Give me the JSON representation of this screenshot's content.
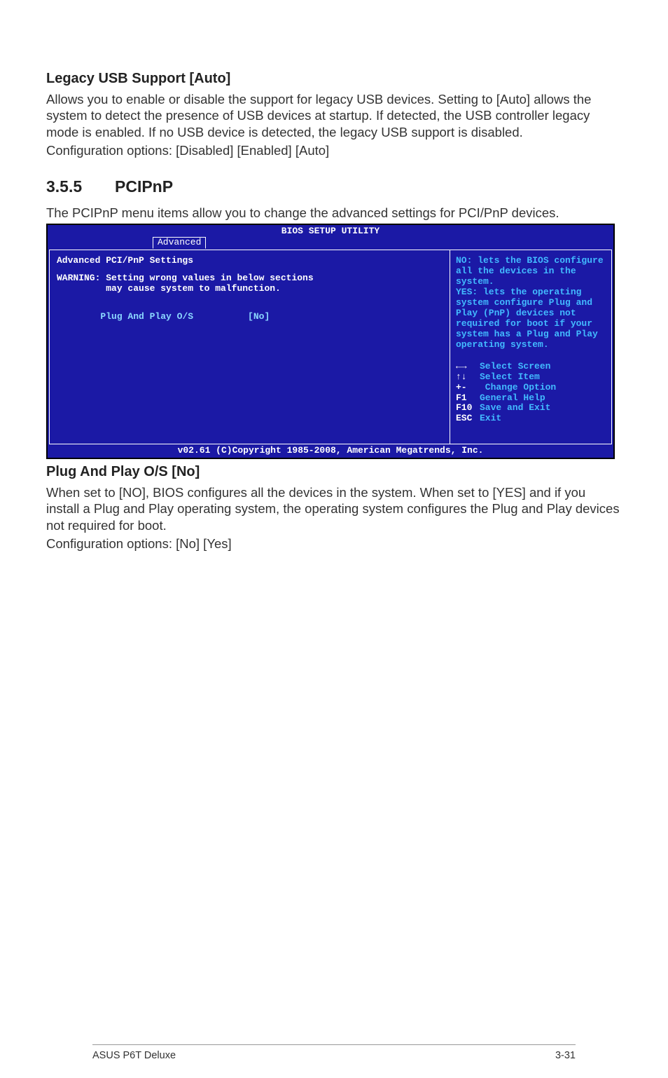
{
  "sect1": {
    "heading": "Legacy USB Support [Auto]",
    "p1": "Allows you to enable or disable the support for legacy USB devices. Setting to [Auto] allows the system to detect the presence of USB devices at startup. If detected, the USB controller legacy mode is enabled. If no USB device is detected, the legacy USB support is disabled.",
    "p2": "Configuration options: [Disabled] [Enabled] [Auto]"
  },
  "sect2": {
    "num": "3.5.5",
    "title": "PCIPnP",
    "p1": "The PCIPnP menu items allow you to change the advanced settings for PCI/PnP devices."
  },
  "bios": {
    "headerTitle": "BIOS SETUP UTILITY",
    "tab": "Advanced",
    "left": {
      "title": "Advanced PCI/PnP Settings",
      "warn1": "WARNING: Setting wrong values in below sections",
      "warn2": "         may cause system to malfunction.",
      "settingLabel": "Plug And Play O/S",
      "settingValue": "[No]"
    },
    "help": "NO: lets the BIOS configure all the devices in the system.\nYES: lets the operating system configure Plug and Play (PnP) devices not required for boot if your system has a Plug and Play operating system.",
    "keys": {
      "arrowsLR": "←→",
      "arrowsUD": "↑↓",
      "selectScreen": "Select Screen",
      "selectItem": "Select Item",
      "pm": "+-",
      "changeOption": " Change Option",
      "f1": "F1",
      "generalHelp": "General Help",
      "f10": "F10",
      "saveExit": "Save and Exit",
      "esc": "ESC",
      "exit": "Exit"
    },
    "footer": "v02.61 (C)Copyright 1985-2008, American Megatrends, Inc."
  },
  "sect3": {
    "heading": "Plug And Play O/S [No]",
    "p1": "When set to [NO], BIOS configures all the devices in the system. When set to [YES] and if you install a Plug and Play operating system, the operating system configures the Plug and Play devices not required for boot.",
    "p2": "Configuration options: [No] [Yes]"
  },
  "footer": {
    "left": "ASUS P6T Deluxe",
    "right": "3-31"
  }
}
